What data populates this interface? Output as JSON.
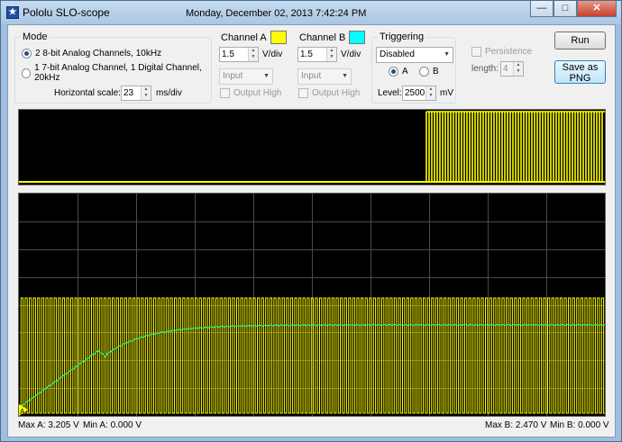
{
  "window": {
    "title": "Pololu SLO-scope",
    "date": "Monday, December 02, 2013 7:42:24 PM",
    "app_icon": "pololu-star-icon",
    "buttons": {
      "minimize": "—",
      "maximize": "□",
      "close": "✕"
    }
  },
  "mode": {
    "legend": "Mode",
    "option1": "2 8-bit Analog Channels, 10kHz",
    "option2": "1 7-bit Analog Channel, 1 Digital Channel, 20kHz",
    "selected": 1,
    "hscale_label": "Horizontal scale:",
    "hscale_value": "23",
    "hscale_unit": "ms/div"
  },
  "channel_a": {
    "legend": "Channel A",
    "color": "#ffff00",
    "vdiv_value": "1.5",
    "vdiv_unit": "V/div",
    "input": "Input",
    "output_high": "Output High"
  },
  "channel_b": {
    "legend": "Channel B",
    "color": "#00ffff",
    "vdiv_value": "1.5",
    "vdiv_unit": "V/div",
    "input": "Input",
    "output_high": "Output High"
  },
  "triggering": {
    "legend": "Triggering",
    "mode": "Disabled",
    "channel_a": "A",
    "channel_b": "B",
    "selected_channel": "A",
    "level_label": "Level:",
    "level_value": "2500",
    "level_unit": "mV"
  },
  "persistence": {
    "label": "Persistence",
    "length_label": "length:",
    "length_value": "4"
  },
  "actions": {
    "run": "Run",
    "save_png": "Save as\nPNG"
  },
  "status": {
    "max_a": "Max A: 3.205 V",
    "min_a": "Min A: 0.000 V",
    "max_b": "Max B: 2.470 V",
    "min_b": "Min B: 0.000 V"
  },
  "trigger_marker": "A",
  "colors": {
    "trace_a": "#ffff00",
    "trace_b": "#33ee88",
    "grid": "#555555",
    "screen": "#000000"
  }
}
